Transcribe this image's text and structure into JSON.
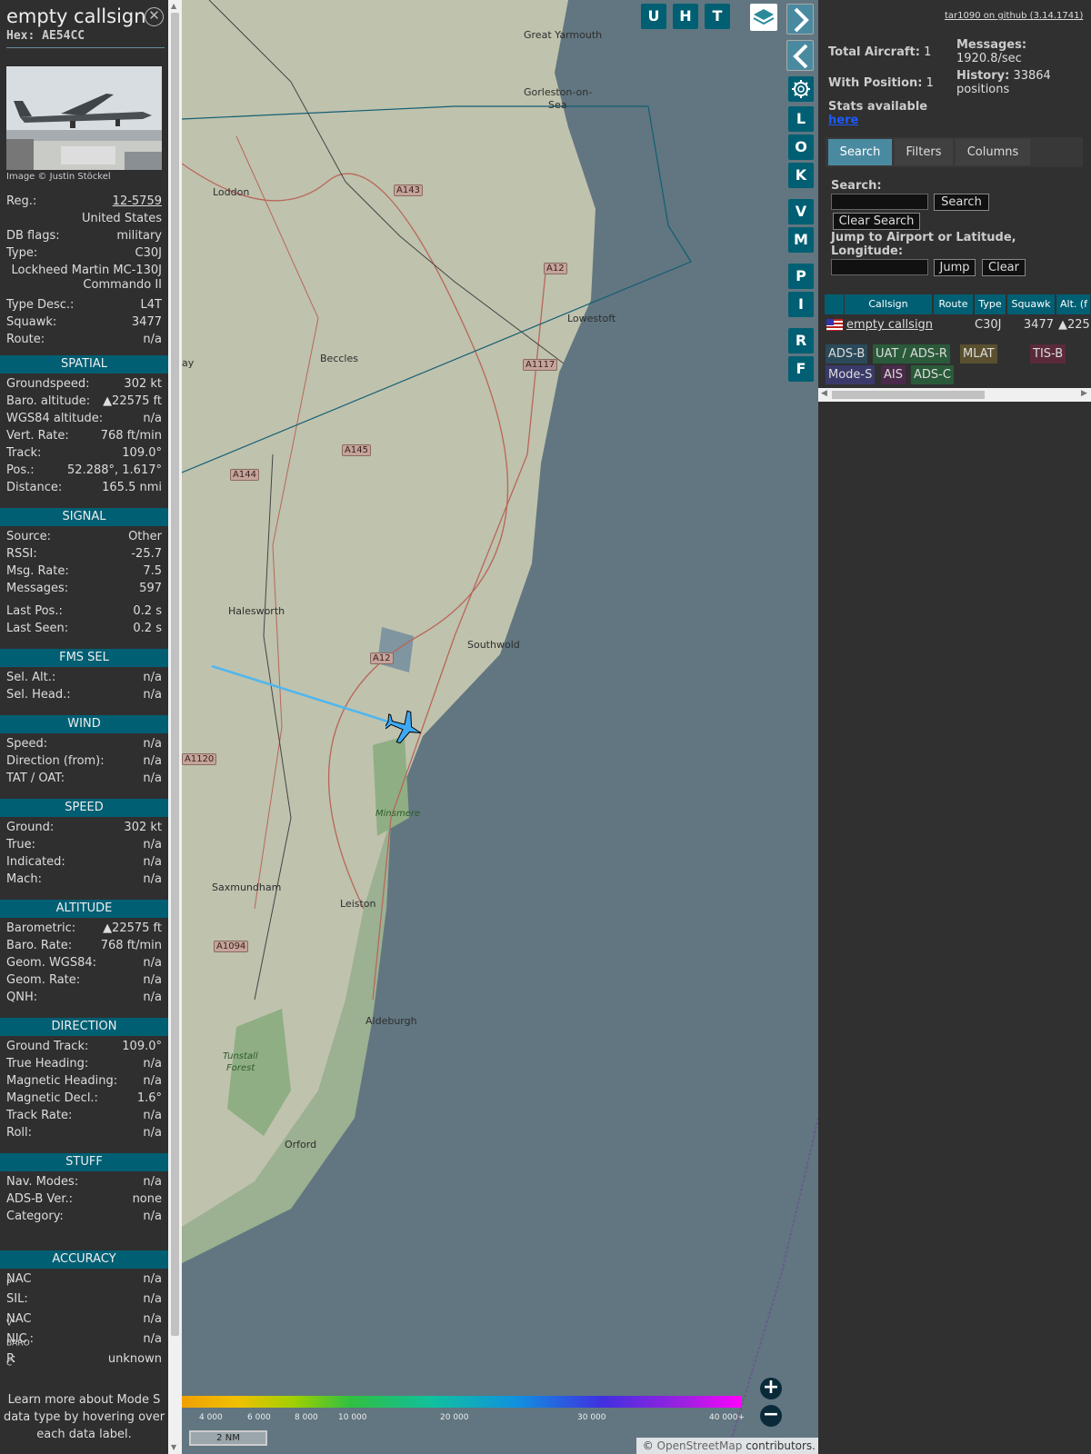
{
  "aircraft": {
    "callsign": "empty callsign",
    "hex": "Hex: AE54CC",
    "photo_credit": "Image © Justin Stöckel",
    "reg_label": "Reg.:",
    "reg": "12-5759",
    "country": "United States",
    "dbflags_label": "DB flags:",
    "dbflags": "military",
    "type_label": "Type:",
    "type": "C30J",
    "model_line1": "Lockheed Martin MC-130J",
    "model_line2": "Commando II",
    "typedesc_label": "Type Desc.:",
    "typedesc": "L4T",
    "squawk_label": "Squawk:",
    "squawk": "3477",
    "route_label": "Route:",
    "route": "n/a"
  },
  "sections": {
    "spatial": "SPATIAL",
    "signal": "SIGNAL",
    "fmssel": "FMS SEL",
    "wind": "WIND",
    "speed": "SPEED",
    "altitude": "ALTITUDE",
    "direction": "DIRECTION",
    "stuff": "STUFF",
    "accuracy": "ACCURACY"
  },
  "spatial": [
    {
      "l": "Groundspeed:",
      "v": "302 kt"
    },
    {
      "l": "Baro. altitude:",
      "v": "▲22575 ft"
    },
    {
      "l": "WGS84 altitude:",
      "v": "n/a"
    },
    {
      "l": "Vert. Rate:",
      "v": "768 ft/min"
    },
    {
      "l": "Track:",
      "v": "109.0°"
    },
    {
      "l": "Pos.:",
      "v": "52.288°, 1.617°"
    },
    {
      "l": "Distance:",
      "v": "165.5 nmi"
    }
  ],
  "signal": [
    {
      "l": "Source:",
      "v": "Other"
    },
    {
      "l": "RSSI:",
      "v": "-25.7"
    },
    {
      "l": "Msg. Rate:",
      "v": "7.5"
    },
    {
      "l": "Messages:",
      "v": "597"
    },
    {
      "l": "Last Pos.:",
      "v": "0.2 s"
    },
    {
      "l": "Last Seen:",
      "v": "0.2 s"
    }
  ],
  "fmssel": [
    {
      "l": "Sel. Alt.:",
      "v": "n/a"
    },
    {
      "l": "Sel. Head.:",
      "v": "n/a"
    }
  ],
  "wind": [
    {
      "l": "Speed:",
      "v": "n/a"
    },
    {
      "l": "Direction (from):",
      "v": "n/a"
    },
    {
      "l": "TAT / OAT:",
      "v": "n/a"
    }
  ],
  "speed": [
    {
      "l": "Ground:",
      "v": "302 kt"
    },
    {
      "l": "True:",
      "v": "n/a"
    },
    {
      "l": "Indicated:",
      "v": "n/a"
    },
    {
      "l": "Mach:",
      "v": "n/a"
    }
  ],
  "altitude": [
    {
      "l": "Barometric:",
      "v": "▲22575 ft"
    },
    {
      "l": "Baro. Rate:",
      "v": "768 ft/min"
    },
    {
      "l": "Geom. WGS84:",
      "v": "n/a"
    },
    {
      "l": "Geom. Rate:",
      "v": "n/a"
    },
    {
      "l": "QNH:",
      "v": "n/a"
    }
  ],
  "direction": [
    {
      "l": "Ground Track:",
      "v": "109.0°"
    },
    {
      "l": "True Heading:",
      "v": "n/a"
    },
    {
      "l": "Magnetic Heading:",
      "v": "n/a"
    },
    {
      "l": "Magnetic Decl.:",
      "v": "1.6°"
    },
    {
      "l": "Track Rate:",
      "v": "n/a"
    },
    {
      "l": "Roll:",
      "v": "n/a"
    }
  ],
  "stuff": [
    {
      "l": "Nav. Modes:",
      "v": "n/a"
    },
    {
      "l": "ADS-B Ver.:",
      "v": "none"
    },
    {
      "l": "Category:",
      "v": "n/a"
    }
  ],
  "accuracy": [
    {
      "l": "NAC",
      "sub": "P",
      "v": "n/a"
    },
    {
      "l": "SIL:",
      "sub": "",
      "v": "n/a"
    },
    {
      "l": "NAC",
      "sub": "V",
      "v": "n/a"
    },
    {
      "l": "NIC",
      "sub": "BARO",
      "v": "n/a"
    },
    {
      "l": "R",
      "sub": "C",
      "v": "unknown"
    }
  ],
  "learn_more": "Learn more about Mode S data type by hovering over each data label.",
  "map": {
    "buttons": [
      "U",
      "H",
      "T"
    ],
    "side_buttons": [
      "L",
      "O",
      "K",
      "V",
      "M",
      "P",
      "I",
      "R",
      "F"
    ],
    "towns": [
      "Great Yarmouth",
      "Gorleston-on-",
      "Sea",
      "Loddon",
      "Lowestoft",
      "Beccles",
      "Halesworth",
      "Southwold",
      "Minsmere",
      "Saxmundham",
      "Leiston",
      "Aldeburgh",
      "Tunstall",
      "Forest",
      "Orford",
      "ay"
    ],
    "roads": [
      "A143",
      "A12",
      "A1117",
      "A145",
      "A144",
      "A12",
      "A1120",
      "A1094"
    ],
    "colorbar_labels": [
      "4 000",
      "6 000",
      "8 000",
      "10 000",
      "20 000",
      "30 000",
      "40 000+"
    ],
    "scale": "2 NM",
    "attribution_prefix": "© ",
    "attribution_link": "OpenStreetMap",
    "attribution_suffix": " contributors.",
    "zoom_in": "+",
    "zoom_out": "−"
  },
  "right": {
    "github": "tar1090 on github (3.14.1741)",
    "total_label": "Total Aircraft:",
    "total": "1",
    "messages_label": "Messages:",
    "messages": "1920.8/sec",
    "withpos_label": "With Position:",
    "withpos": "1",
    "history_label": "History:",
    "history": "33864",
    "history_unit": "positions",
    "stats_label": "Stats available",
    "stats_link": "here",
    "tabs": [
      "Search",
      "Filters",
      "Columns"
    ],
    "search_label": "Search:",
    "search_btn": "Search",
    "clear_search_btn": "Clear Search",
    "jump_label": "Jump to Airport or Latitude, Longitude:",
    "jump_btn": "Jump",
    "clear_btn": "Clear",
    "columns": [
      "Callsign",
      "Route",
      "Type",
      "Squawk",
      "Alt. (f"
    ],
    "row": {
      "callsign": "empty callsign",
      "type": "C30J",
      "squawk": "3477",
      "alt": "▲225"
    },
    "badges": [
      "ADS-B",
      "UAT / ADS-R",
      "MLAT",
      "TIS-B",
      "Mode-S",
      "AIS",
      "ADS-C"
    ]
  },
  "colors": {
    "accent": "#005f73",
    "track": "#4fb6ef",
    "aircraft": "#3fa9f5"
  }
}
